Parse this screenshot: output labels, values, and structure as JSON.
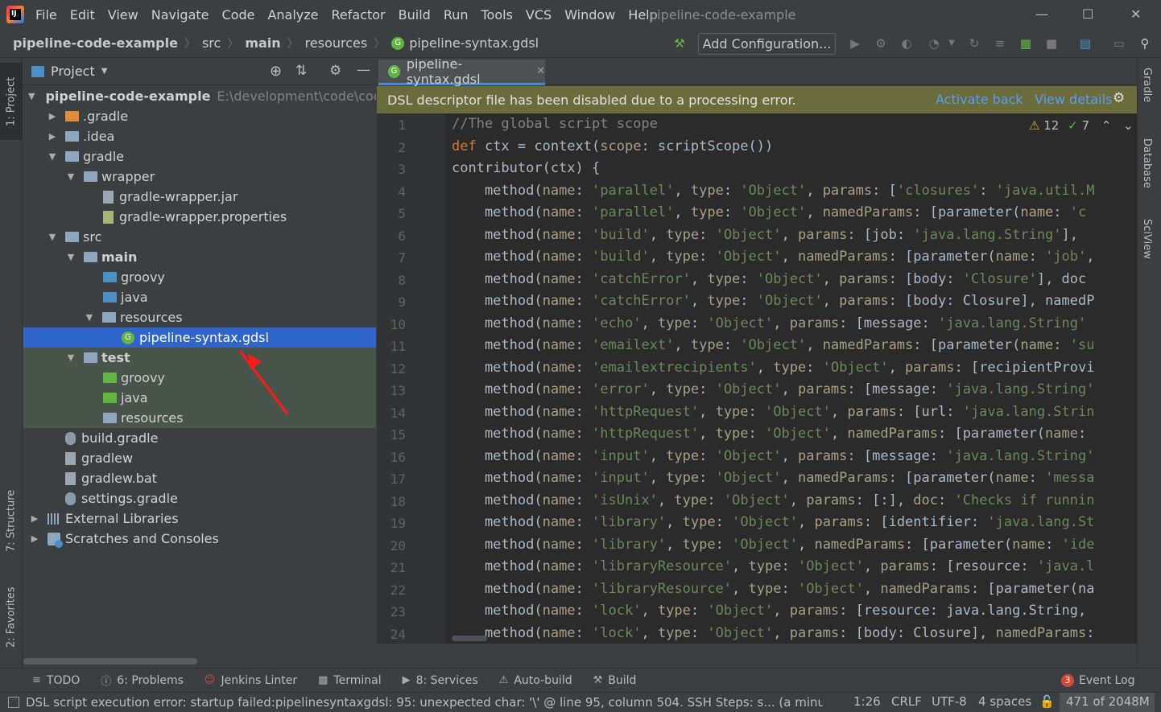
{
  "menu": {
    "items": [
      "File",
      "Edit",
      "View",
      "Navigate",
      "Code",
      "Analyze",
      "Refactor",
      "Build",
      "Run",
      "Tools",
      "VCS",
      "Window",
      "Help"
    ],
    "window_title": "pipeline-code-example"
  },
  "breadcrumb": {
    "project": "pipeline-code-example",
    "src": "src",
    "main": "main",
    "resources": "resources",
    "file": "pipeline-syntax.gdsl"
  },
  "toolbar": {
    "add_configuration": "Add Configuration..."
  },
  "left_strip": {
    "project": "1: Project",
    "structure": "7: Structure",
    "favorites": "2: Favorites"
  },
  "right_strip": {
    "gradle": "Gradle",
    "database": "Database",
    "sciview": "SciView"
  },
  "project_panel": {
    "title": "Project",
    "tree": [
      {
        "label": "pipeline-code-example",
        "path": "E:\\development\\code\\code"
      },
      {
        "label": ".gradle"
      },
      {
        "label": ".idea"
      },
      {
        "label": "gradle"
      },
      {
        "label": "wrapper"
      },
      {
        "label": "gradle-wrapper.jar"
      },
      {
        "label": "gradle-wrapper.properties"
      },
      {
        "label": "src"
      },
      {
        "label": "main"
      },
      {
        "label": "groovy"
      },
      {
        "label": "java"
      },
      {
        "label": "resources"
      },
      {
        "label": "pipeline-syntax.gdsl"
      },
      {
        "label": "test"
      },
      {
        "label": "groovy"
      },
      {
        "label": "java"
      },
      {
        "label": "resources"
      },
      {
        "label": "build.gradle"
      },
      {
        "label": "gradlew"
      },
      {
        "label": "gradlew.bat"
      },
      {
        "label": "settings.gradle"
      },
      {
        "label": "External Libraries"
      },
      {
        "label": "Scratches and Consoles"
      }
    ]
  },
  "editor": {
    "tab": "pipeline-syntax.gdsl",
    "banner": {
      "message": "DSL descriptor file has been disabled due to a processing error.",
      "activate": "Activate back",
      "details": "View details"
    },
    "inspections": {
      "warnings": "12",
      "weak": "7"
    },
    "line_numbers": [
      "1",
      "2",
      "3",
      "4",
      "5",
      "6",
      "7",
      "8",
      "9",
      "10",
      "11",
      "12",
      "13",
      "14",
      "15",
      "16",
      "17",
      "18",
      "19",
      "20",
      "21",
      "22",
      "23",
      "24"
    ],
    "lines": [
      "//The global script scope",
      "def ctx = context(scope: scriptScope())",
      "contributor(ctx) {",
      "    method(name: 'parallel', type: 'Object', params: ['closures': 'java.util.M",
      "    method(name: 'parallel', type: 'Object', namedParams: [parameter(name: 'c",
      "    method(name: 'build', type: 'Object', params: [job: 'java.lang.String'],",
      "    method(name: 'build', type: 'Object', namedParams: [parameter(name: 'job',",
      "    method(name: 'catchError', type: 'Object', params: [body: 'Closure'], doc",
      "    method(name: 'catchError', type: 'Object', params: [body: Closure], namedP",
      "    method(name: 'echo', type: 'Object', params: [message: 'java.lang.String'",
      "    method(name: 'emailext', type: 'Object', namedParams: [parameter(name: 'su",
      "    method(name: 'emailextrecipients', type: 'Object', params: [recipientProvi",
      "    method(name: 'error', type: 'Object', params: [message: 'java.lang.String'",
      "    method(name: 'httpRequest', type: 'Object', params: [url: 'java.lang.Strin",
      "    method(name: 'httpRequest', type: 'Object', namedParams: [parameter(name:",
      "    method(name: 'input', type: 'Object', params: [message: 'java.lang.String'",
      "    method(name: 'input', type: 'Object', namedParams: [parameter(name: 'messa",
      "    method(name: 'isUnix', type: 'Object', params: [:], doc: 'Checks if runnin",
      "    method(name: 'library', type: 'Object', params: [identifier: 'java.lang.St",
      "    method(name: 'library', type: 'Object', namedParams: [parameter(name: 'ide",
      "    method(name: 'libraryResource', type: 'Object', params: [resource: 'java.l",
      "    method(name: 'libraryResource', type: 'Object', namedParams: [parameter(na",
      "    method(name: 'lock', type: 'Object', params: [resource: java.lang.String,",
      "    method(name: 'lock', type: 'Object', params: [body: Closure], namedParams:"
    ]
  },
  "bottom_tabs": [
    "TODO",
    "6: Problems",
    "Jenkins Linter",
    "Terminal",
    "8: Services",
    "Auto-build",
    "Build",
    "Event Log"
  ],
  "event_log_count": "3",
  "status": {
    "message": "DSL script execution error: startup failed:pipelinesyntaxgdsl: 95: unexpected char: '\\' @ line 95, column 504.  SSH Steps: s... (a minute ag",
    "position": "1:26",
    "line_sep": "CRLF",
    "encoding": "UTF-8",
    "indent": "4 spaces",
    "memory": "471 of 2048M"
  },
  "colors": {
    "accent": "#2f65ca",
    "banner": "#6b6c3c",
    "link": "#589df6",
    "annotation_arrow": "#ff1a1a"
  }
}
